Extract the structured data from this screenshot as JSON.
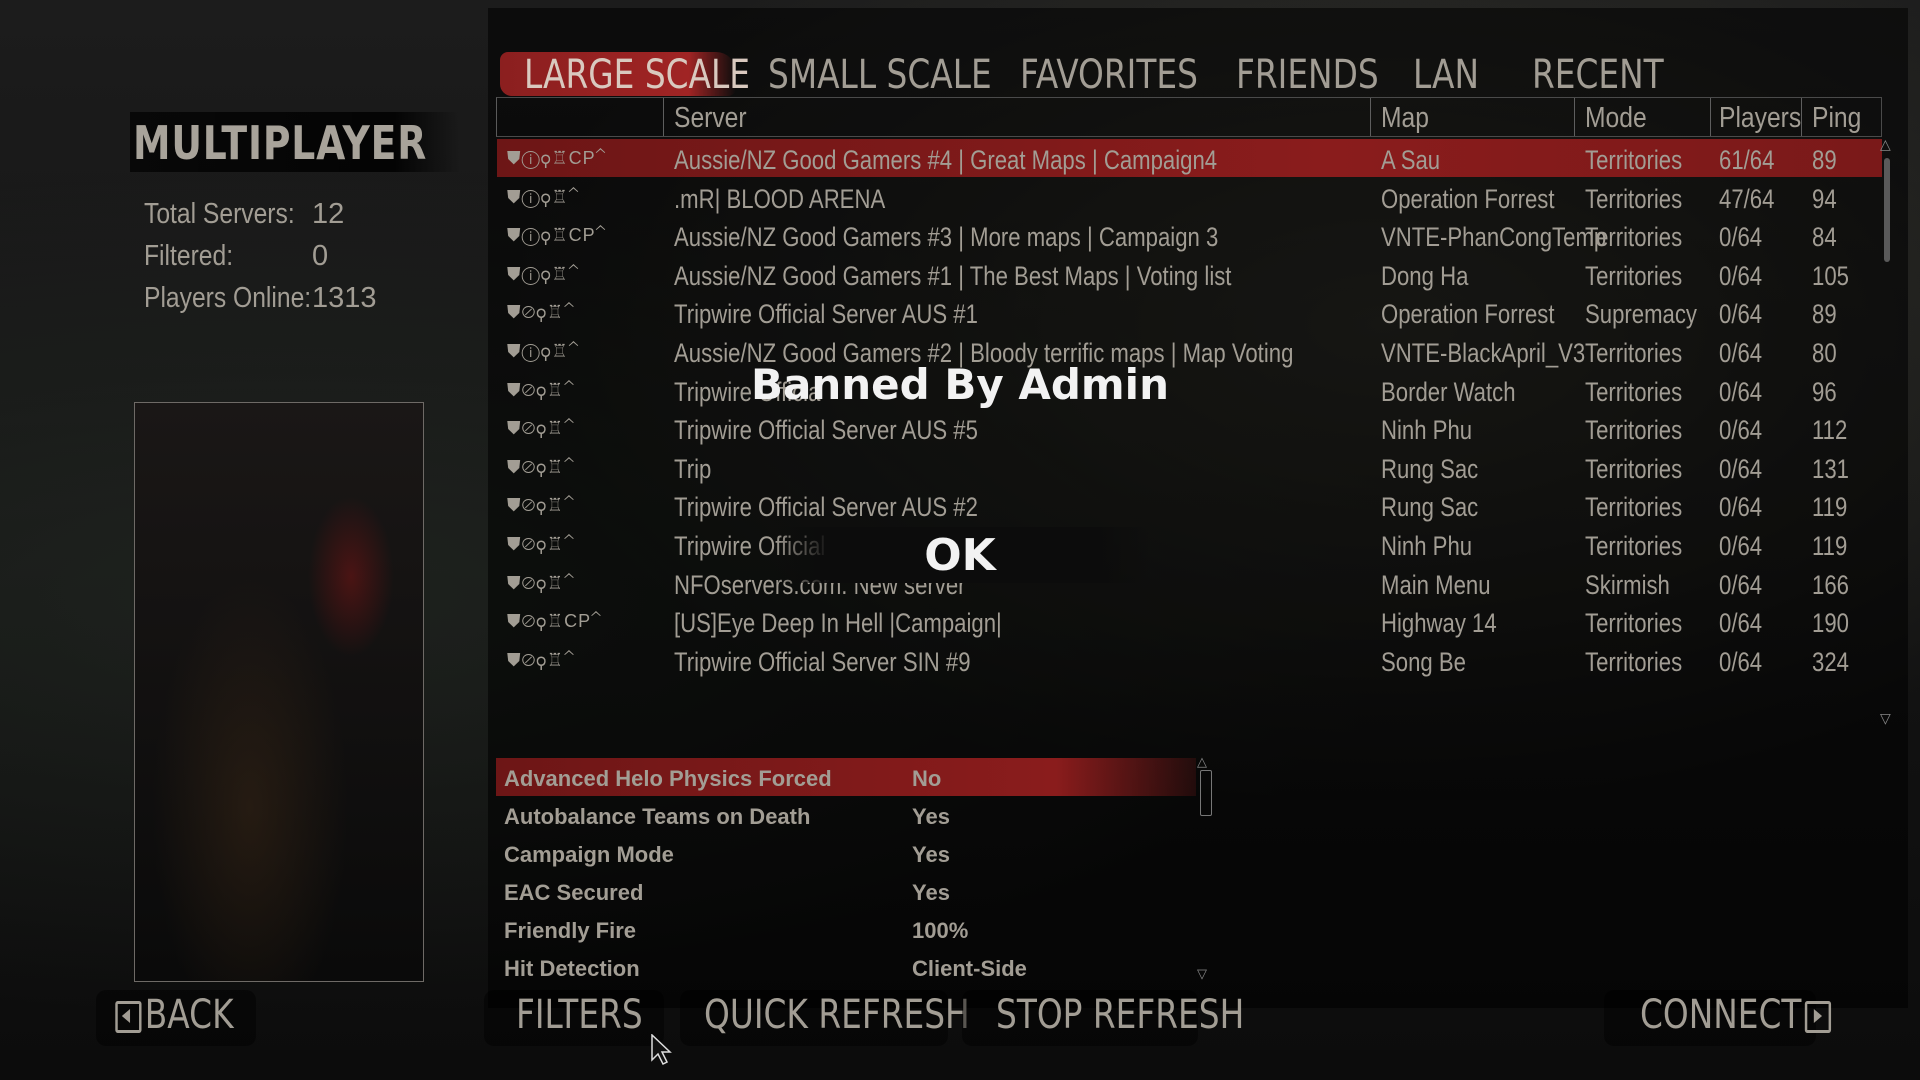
{
  "left": {
    "title": "MULTIPLAYER",
    "stats": [
      {
        "label": "Total Servers:",
        "value": "12"
      },
      {
        "label": "Filtered:",
        "value": "0"
      },
      {
        "label": "Players Online:",
        "value": "1313"
      }
    ]
  },
  "tabs": [
    "LARGE SCALE",
    "SMALL SCALE",
    "FAVORITES",
    "FRIENDS",
    "LAN",
    "RECENT"
  ],
  "active_tab": "LARGE SCALE",
  "columns": {
    "server": "Server",
    "map": "Map",
    "mode": "Mode",
    "players": "Players",
    "ping": "Ping"
  },
  "servers": [
    {
      "icons": "⛊ⓘ⚲♖CP⌃",
      "name": "Aussie/NZ Good Gamers #4 | Great Maps | Campaign4",
      "map": "A Sau",
      "mode": "Territories",
      "players": "61/64",
      "ping": "89"
    },
    {
      "icons": "⛊ⓘ⚲♖⌃",
      "name": ".mR| BLOOD ARENA",
      "map": "Operation Forrest",
      "mode": "Territories",
      "players": "47/64",
      "ping": "94"
    },
    {
      "icons": "⛊ⓘ⚲♖CP⌃",
      "name": "Aussie/NZ Good Gamers #3 | More maps | Campaign 3",
      "map": "VNTE-PhanCongTemp",
      "mode": "Territories",
      "players": "0/64",
      "ping": "84"
    },
    {
      "icons": "⛊ⓘ⚲♖⌃",
      "name": "Aussie/NZ Good Gamers #1 | The Best Maps | Voting list",
      "map": "Dong Ha",
      "mode": "Territories",
      "players": "0/64",
      "ping": "105"
    },
    {
      "icons": "⛊⊘⚲♖⌃",
      "name": "Tripwire Official Server AUS #1",
      "map": "Operation Forrest",
      "mode": "Supremacy",
      "players": "0/64",
      "ping": "89"
    },
    {
      "icons": "⛊ⓘ⚲♖⌃",
      "name": "Aussie/NZ Good Gamers #2 | Bloody terrific maps | Map Voting",
      "map": "VNTE-BlackApril_V3",
      "mode": "Territories",
      "players": "0/64",
      "ping": "80"
    },
    {
      "icons": "⛊⊘⚲♖⌃",
      "name": "Tripwire Officia",
      "map": "Border Watch",
      "mode": "Territories",
      "players": "0/64",
      "ping": "96"
    },
    {
      "icons": "⛊⊘⚲♖⌃",
      "name": "Tripwire Official Server AUS #5",
      "map": "Ninh Phu",
      "mode": "Territories",
      "players": "0/64",
      "ping": "112"
    },
    {
      "icons": "⛊⊘⚲♖⌃",
      "name": "Trip",
      "map": "Rung Sac",
      "mode": "Territories",
      "players": "0/64",
      "ping": "131"
    },
    {
      "icons": "⛊⊘⚲♖⌃",
      "name": "Tripwire Official Server AUS #2",
      "map": "Rung Sac",
      "mode": "Territories",
      "players": "0/64",
      "ping": "119"
    },
    {
      "icons": "⛊⊘⚲♖⌃",
      "name": "Tripwire Official Server AUS #3",
      "map": "Ninh Phu",
      "mode": "Territories",
      "players": "0/64",
      "ping": "119"
    },
    {
      "icons": "⛊⊘⚲♖⌃",
      "name": "NFOservers.com: New server",
      "map": "Main Menu",
      "mode": "Skirmish",
      "players": "0/64",
      "ping": "166"
    },
    {
      "icons": "⛊⊘⚲♖CP⌃",
      "name": "[US]Eye Deep In Hell |Campaign|",
      "map": "Highway 14",
      "mode": "Territories",
      "players": "0/64",
      "ping": "190"
    },
    {
      "icons": "⛊⊘⚲♖⌃",
      "name": "Tripwire Official Server SIN #9",
      "map": "Song Be",
      "mode": "Territories",
      "players": "0/64",
      "ping": "324"
    }
  ],
  "details": [
    {
      "key": "Advanced Helo Physics Forced",
      "value": "No"
    },
    {
      "key": "Autobalance Teams on Death",
      "value": "Yes"
    },
    {
      "key": "Campaign Mode",
      "value": "Yes"
    },
    {
      "key": "EAC Secured",
      "value": "Yes"
    },
    {
      "key": "Friendly Fire",
      "value": "100%"
    },
    {
      "key": "Hit Detection",
      "value": "Client-Side"
    }
  ],
  "buttons": {
    "back": "BACK",
    "filters": "FILTERS",
    "quick_refresh": "QUICK REFRESH",
    "stop_refresh": "STOP REFRESH",
    "connect": "CONNECT"
  },
  "dialog": {
    "title": "Banned By Admin",
    "ok": "OK"
  },
  "colors": {
    "highlight": "#8a1c1c",
    "text": "#a29d94",
    "dialog_text": "#f2f2f2"
  }
}
